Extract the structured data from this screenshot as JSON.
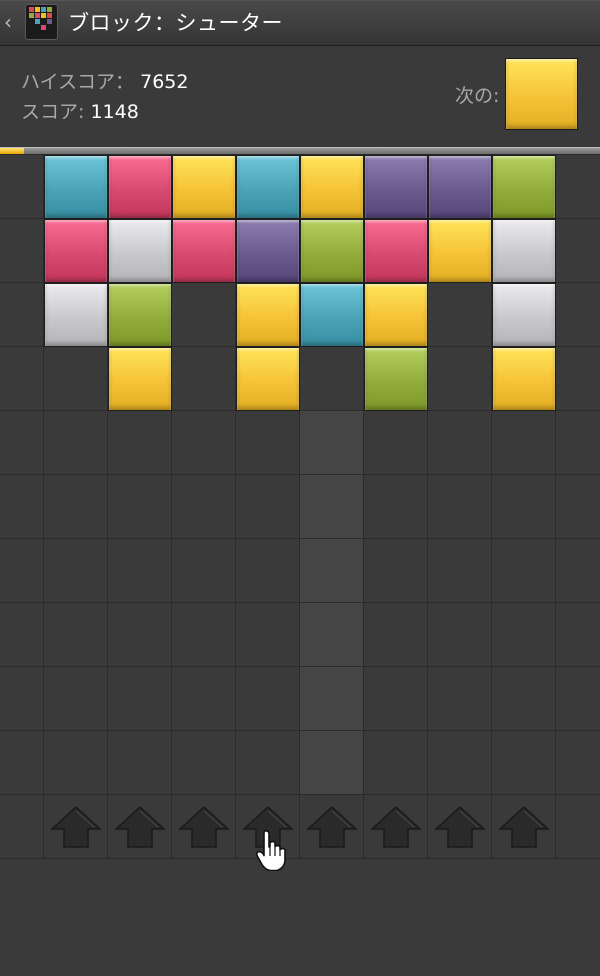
{
  "app_bar": {
    "back_icon": "chevron-left-icon",
    "app_icon": "block-shooter-app-icon",
    "title": "ブロック：シューター"
  },
  "scores": {
    "high_label": "ハイスコア：",
    "high_value": "7652",
    "score_label": "スコア:",
    "score_value": "1148"
  },
  "next": {
    "label": "次の:",
    "color": "yellow"
  },
  "progress": {
    "fraction": 0.04,
    "color": "#f2c21a"
  },
  "colors": {
    "teal": "#4aa3b6",
    "pink": "#d84a70",
    "yellow": "#f6c237",
    "purple": "#6a5a8e",
    "green": "#93ad3c",
    "silver": "#c9c8cc"
  },
  "board": {
    "columns": 8,
    "stacks": [
      [
        "teal",
        "pink",
        "silver"
      ],
      [
        "pink",
        "silver",
        "green",
        "yellow"
      ],
      [
        "yellow",
        "pink"
      ],
      [
        "teal",
        "purple",
        "yellow",
        "yellow"
      ],
      [
        "yellow",
        "green",
        "teal"
      ],
      [
        "purple",
        "pink",
        "yellow",
        "green"
      ],
      [
        "purple",
        "yellow"
      ],
      [
        "green",
        "silver",
        "silver",
        "yellow"
      ]
    ],
    "active_column": 4
  },
  "shooter": {
    "icon": "up-arrow-icon",
    "count": 8
  },
  "cursor": {
    "icon": "hand-pointer-icon"
  }
}
